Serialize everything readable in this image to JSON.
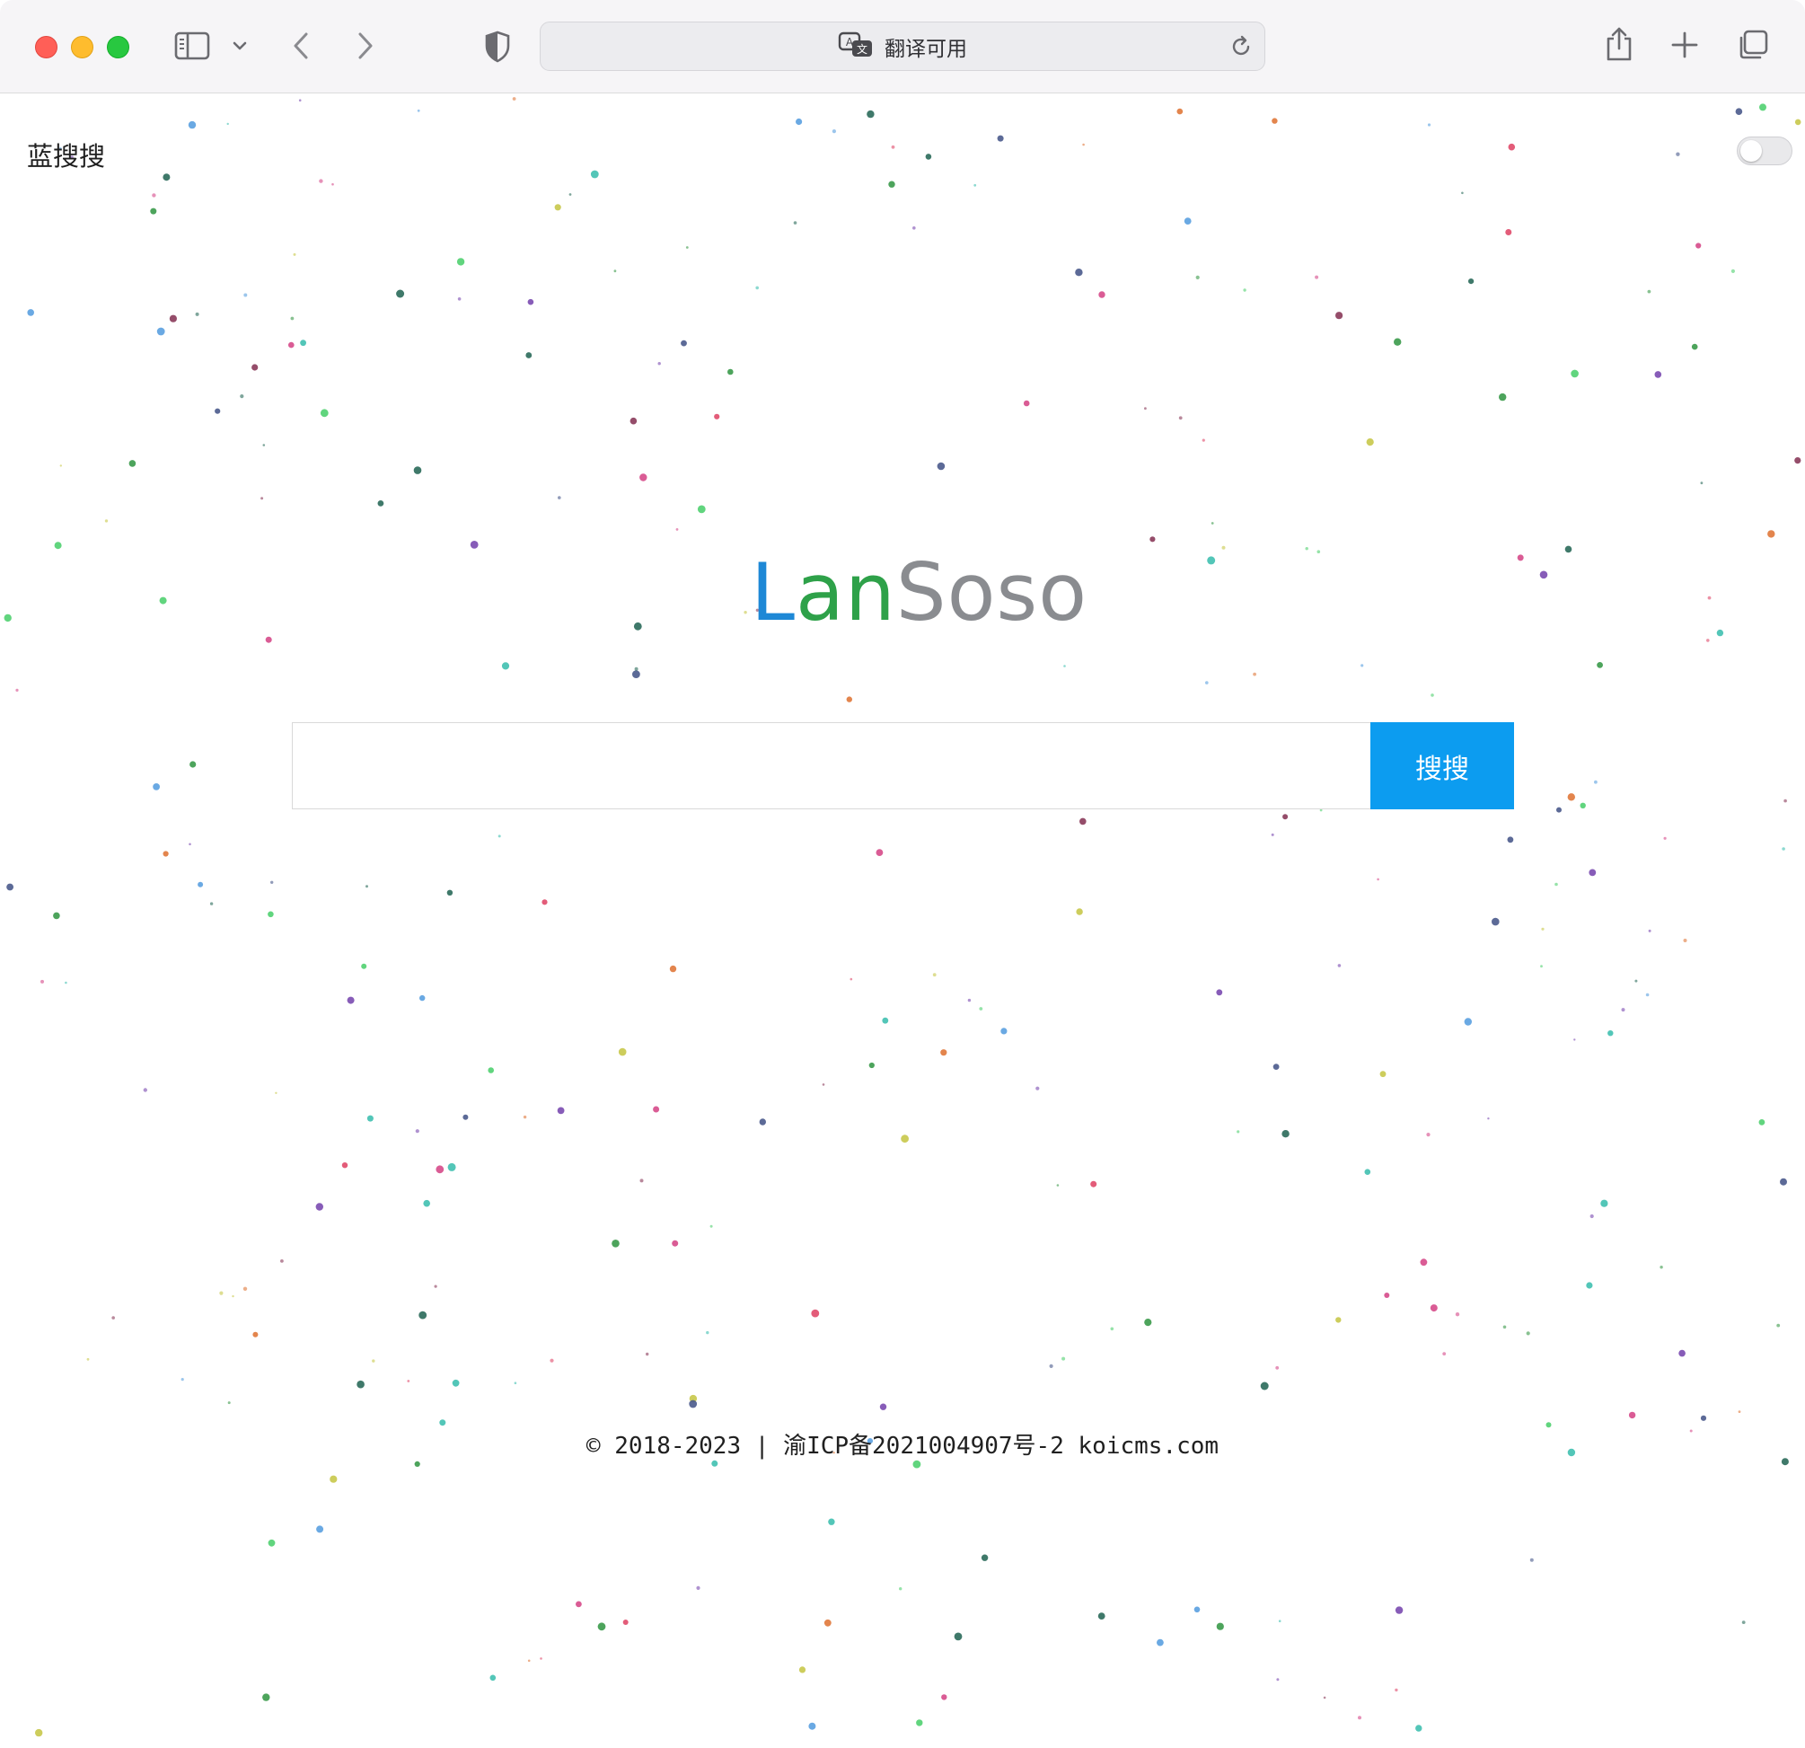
{
  "browser": {
    "address_text": "翻译可用",
    "icons": [
      "sidebar-icon",
      "chevron-down-icon",
      "back-icon",
      "forward-icon",
      "shield-icon",
      "translate-icon",
      "reload-icon",
      "share-icon",
      "new-tab-icon",
      "tabs-overview-icon"
    ]
  },
  "page": {
    "site_name": "蓝搜搜",
    "logo": {
      "part1": "L",
      "part2": "an",
      "part3": "Soso",
      "colors": {
        "part1": "#1e88d6",
        "part2": "#2ea149",
        "part3": "#8a8c90"
      }
    },
    "search": {
      "value": "",
      "placeholder": "",
      "button_label": "搜搜",
      "button_color": "#0c9cf0"
    },
    "toggle": {
      "state": "off"
    },
    "footer": "© 2018-2023 | 渝ICP备2021004907号-2 koicms.com"
  }
}
